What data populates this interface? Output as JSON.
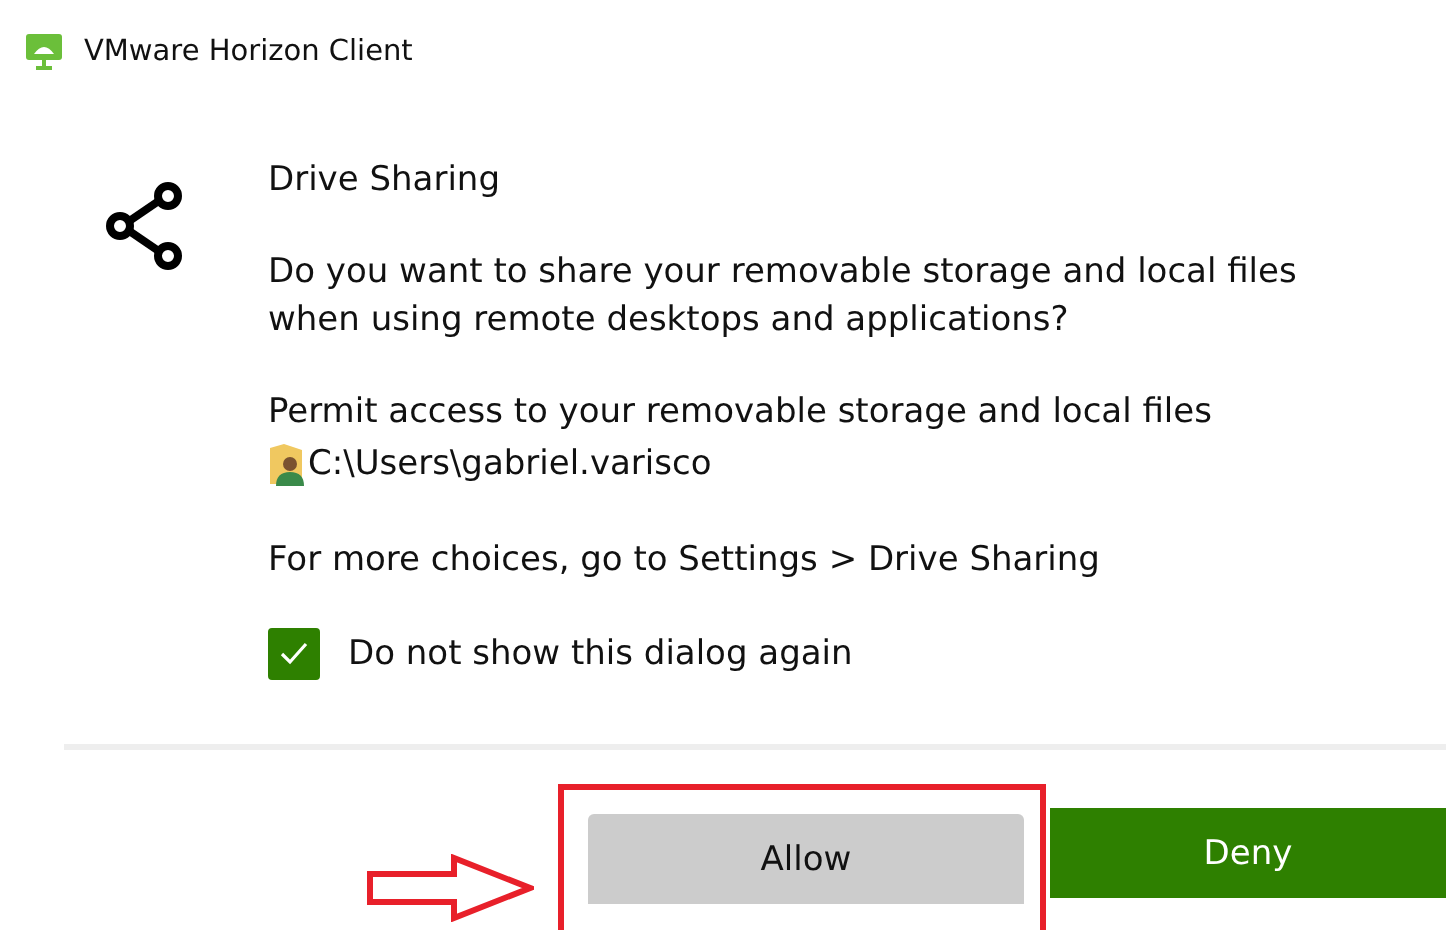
{
  "window": {
    "title": "VMware Horizon Client"
  },
  "dialog": {
    "heading": "Drive Sharing",
    "question": "Do you want to share your removable storage and local files when using remote desktops and applications?",
    "permit": "Permit access to your removable storage and local files",
    "path": "C:\\Users\\gabriel.varisco",
    "more": "For more choices, go to Settings > Drive Sharing"
  },
  "checkbox": {
    "label": "Do not show this dialog again",
    "checked": true
  },
  "buttons": [
    {
      "label": "Allow",
      "kind": "secondary",
      "highlighted": true
    },
    {
      "label": "Deny",
      "kind": "primary",
      "highlighted": false
    }
  ]
}
